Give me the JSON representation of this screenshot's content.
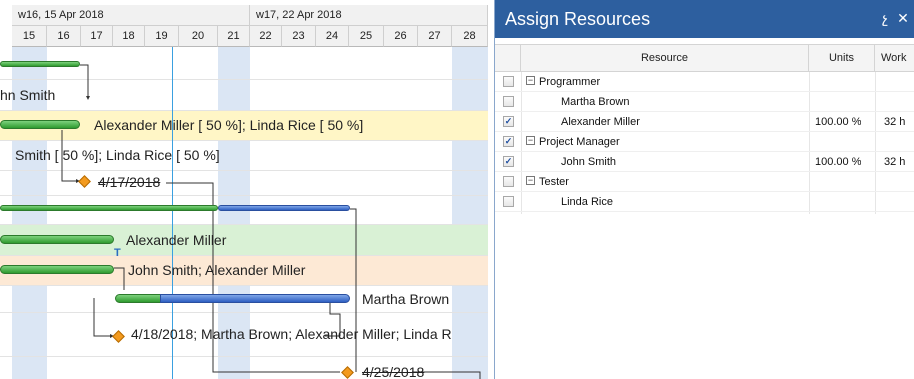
{
  "timeline": {
    "weeks": [
      {
        "label": "w16, 15 Apr 2018"
      },
      {
        "label": "w17, 22 Apr 2018"
      }
    ],
    "days": [
      "15",
      "16",
      "17",
      "18",
      "19",
      "20",
      "21",
      "22",
      "23",
      "24",
      "25",
      "26",
      "27",
      "28"
    ]
  },
  "gantt": {
    "labels": {
      "row2": "hn Smith",
      "row3": "Alexander Miller [ 50 %]; Linda Rice [ 50 %]",
      "row4": "Smith [ 50 %]; Linda Rice [ 50 %]",
      "row5_milestone": "4/17/2018",
      "row7": "Alexander Miller",
      "row8": "John Smith; Alexander Miller",
      "row9": "Martha Brown",
      "row10_milestone": "4/18/2018; Martha Brown; Alexander Miller; Linda R",
      "row11_milestone": "4/25/2018"
    },
    "colors": {
      "assigned_highlight": "#fff6c6",
      "green_row": "#d9f1d5",
      "orange_row": "#fde9d5",
      "weekend": "#dbe6f4",
      "today_line": "#3aa0e0"
    }
  },
  "panel": {
    "title": "Assign Resources",
    "icons": [
      "pin-icon",
      "close-icon"
    ],
    "pin_glyph": "չ",
    "close_glyph": "✕",
    "columns": [
      "Resource",
      "Units",
      "Work"
    ],
    "rows": [
      {
        "resource": "Programmer",
        "units": "",
        "work": "",
        "group": true,
        "checked": false,
        "expand": "−"
      },
      {
        "resource": "Martha Brown",
        "units": "",
        "work": "",
        "group": false,
        "checked": false
      },
      {
        "resource": "Alexander Miller",
        "units": "100.00 %",
        "work": "32 h",
        "group": false,
        "checked": true
      },
      {
        "resource": "Project Manager",
        "units": "",
        "work": "",
        "group": true,
        "checked": true,
        "expand": "−"
      },
      {
        "resource": "John Smith",
        "units": "100.00 %",
        "work": "32 h",
        "group": false,
        "checked": true
      },
      {
        "resource": "Tester",
        "units": "",
        "work": "",
        "group": true,
        "checked": false,
        "expand": "−"
      },
      {
        "resource": "Linda Rice",
        "units": "",
        "work": "",
        "group": false,
        "checked": false
      }
    ],
    "check_glyph": "✓"
  }
}
